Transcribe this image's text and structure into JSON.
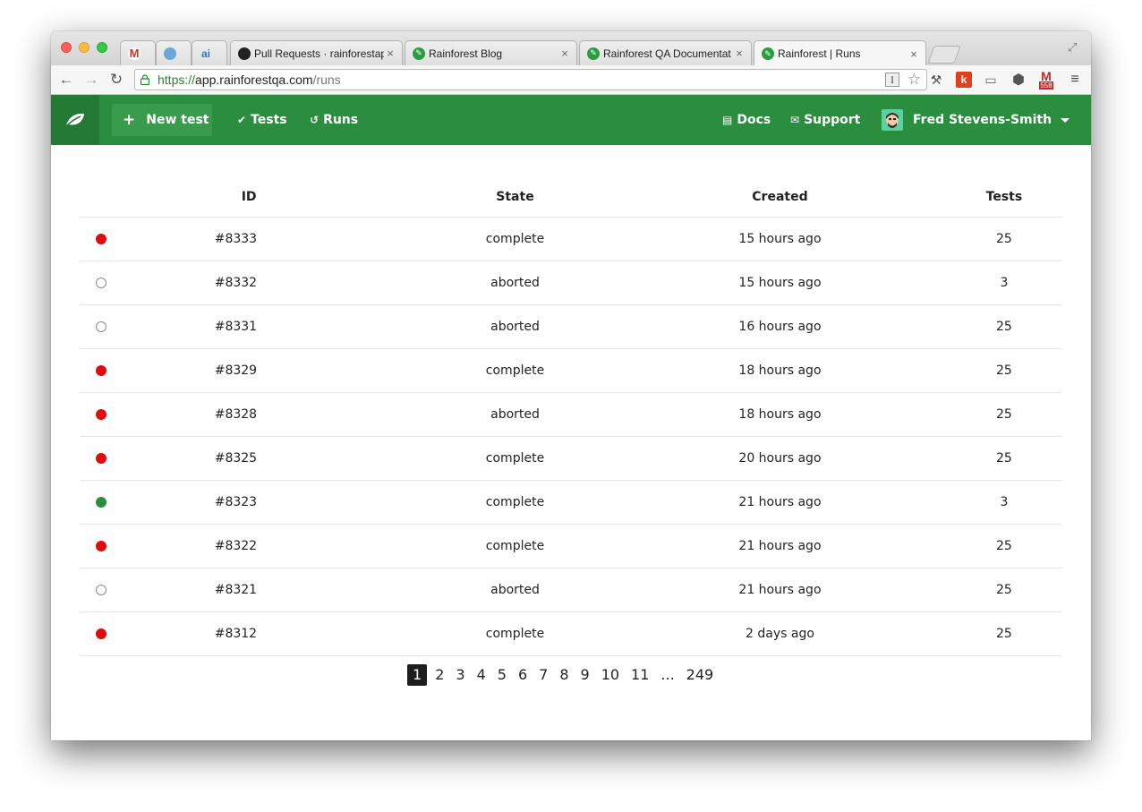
{
  "browser": {
    "tabs": [
      {
        "label": "",
        "icon": "gmail-icon"
      },
      {
        "label": "",
        "icon": "database-icon"
      },
      {
        "label": "",
        "icon": "ai-icon"
      },
      {
        "label": "Pull Requests · rainforestap",
        "icon": "github-icon"
      },
      {
        "label": "Rainforest Blog",
        "icon": "rainforest-icon"
      },
      {
        "label": "Rainforest QA Documentat",
        "icon": "rainforest-icon"
      },
      {
        "label": "Rainforest | Runs",
        "icon": "rainforest-icon",
        "active": true
      }
    ],
    "url": {
      "scheme": "https://",
      "host": "app.rainforestqa.com",
      "path": "/runs"
    },
    "extensions": {
      "gmail_count": "558"
    }
  },
  "nav": {
    "new_test": "New test",
    "tests": "Tests",
    "runs": "Runs",
    "docs": "Docs",
    "support": "Support",
    "user": "Fred Stevens-Smith"
  },
  "table": {
    "headers": {
      "id": "ID",
      "state": "State",
      "created": "Created",
      "tests": "Tests"
    },
    "rows": [
      {
        "status": "failed",
        "id": "#8333",
        "state": "complete",
        "created": "15 hours ago",
        "tests": "25"
      },
      {
        "status": "aborted",
        "id": "#8332",
        "state": "aborted",
        "created": "15 hours ago",
        "tests": "3"
      },
      {
        "status": "aborted",
        "id": "#8331",
        "state": "aborted",
        "created": "16 hours ago",
        "tests": "25"
      },
      {
        "status": "failed",
        "id": "#8329",
        "state": "complete",
        "created": "18 hours ago",
        "tests": "25"
      },
      {
        "status": "failed",
        "id": "#8328",
        "state": "aborted",
        "created": "18 hours ago",
        "tests": "25"
      },
      {
        "status": "failed",
        "id": "#8325",
        "state": "complete",
        "created": "20 hours ago",
        "tests": "25"
      },
      {
        "status": "passed",
        "id": "#8323",
        "state": "complete",
        "created": "21 hours ago",
        "tests": "3"
      },
      {
        "status": "failed",
        "id": "#8322",
        "state": "complete",
        "created": "21 hours ago",
        "tests": "25"
      },
      {
        "status": "aborted",
        "id": "#8321",
        "state": "aborted",
        "created": "21 hours ago",
        "tests": "25"
      },
      {
        "status": "failed",
        "id": "#8312",
        "state": "complete",
        "created": "2 days ago",
        "tests": "25"
      }
    ]
  },
  "pagination": {
    "current": "1",
    "pages": [
      "2",
      "3",
      "4",
      "5",
      "6",
      "7",
      "8",
      "9",
      "10",
      "11"
    ],
    "ellipsis": "...",
    "last": "249"
  },
  "colors": {
    "brand_green": "#2a8e3e",
    "failed_red": "#e00b0b",
    "passed_green": "#2a8e3e"
  }
}
